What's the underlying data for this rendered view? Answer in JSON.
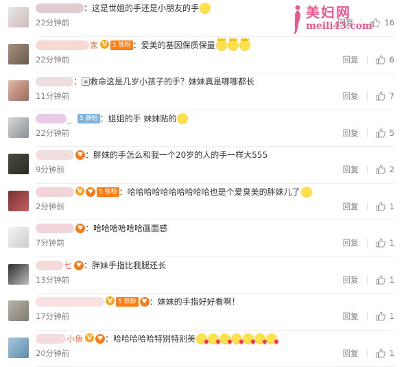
{
  "watermark": {
    "line1": "美妇网",
    "line2": "meili43.com"
  },
  "icons": {
    "like": "thumbs-up-icon"
  },
  "colors": {
    "name_tail": "#eb7350",
    "link_time": "#808080",
    "vip": "#ffa31a"
  },
  "comments": [
    {
      "name_tail": "",
      "name_blur_color": "#c9a4a8",
      "name_blur_width": 70,
      "badges": [],
      "text": "：这是世姐的手还是小朋友的手",
      "emojis": [
        "smile"
      ],
      "time": "22分钟前",
      "reply": "回复",
      "likes": "16",
      "avatar": [
        "#e9e9e9",
        "#d0b8b8"
      ]
    },
    {
      "name_tail": "家",
      "name_blur_color": "#f0b9b0",
      "name_blur_width": 78,
      "badges": [
        "v",
        "lvl-orange-铁粉"
      ],
      "text": "：爱美的基因保质保量",
      "emojis": [
        "crown",
        "crown",
        "crown"
      ],
      "time": "22分钟前",
      "reply": "回复",
      "likes": "6",
      "avatar": [
        "#a7907c",
        "#6b5a50"
      ]
    },
    {
      "name_tail": "",
      "name_blur_color": "#dcc2c2",
      "name_blur_width": 55,
      "badges": [],
      "text": "：救命这是几岁小孩子的手？妹妹真是哪哪都长",
      "emojis": [],
      "pre_icon": "▣",
      "time": "11分钟前",
      "reply": "回复",
      "likes": "7",
      "avatar": [
        "#e3b6a8",
        "#9c6b5d"
      ]
    },
    {
      "name_tail": "_",
      "name_blur_color": "#d8a3d3",
      "name_blur_width": 45,
      "badges": [
        "lvl-blue-铁粉"
      ],
      "text": "：姐姐的手 妹妹贴的",
      "emojis": [
        "smile"
      ],
      "time": "22分钟前",
      "reply": "回复",
      "likes": "5",
      "avatar": [
        "#d8d8d8",
        "#8a9096"
      ]
    },
    {
      "name_tail": "",
      "name_blur_color": "#e8c2c2",
      "name_blur_width": 56,
      "badges": [
        "heart"
      ],
      "text": "：胖妹的手怎么和我一个20岁的人的手一样大555",
      "emojis": [],
      "time": "9分钟前",
      "reply": "回复",
      "likes": "2",
      "avatar": [
        "#4c4c40",
        "#2a2a22"
      ]
    },
    {
      "name_tail": "",
      "name_blur_color": "#eab0b8",
      "name_blur_width": 56,
      "badges": [
        "v",
        "heart",
        "lvl-orange-铁粉"
      ],
      "text": "：哈哈哈哈哈哈哈哈哈哈也是个爱臭美的胖妹儿了",
      "emojis": [
        "laugh"
      ],
      "time": "2分钟前",
      "reply": "回复",
      "likes": "1",
      "avatar": [
        "#7a2f2f",
        "#c46060"
      ]
    },
    {
      "name_tail": "",
      "name_blur_color": "#e4b4bc",
      "name_blur_width": 56,
      "badges": [
        "heart"
      ],
      "text": "：哈哈哈哈哈哈画面感",
      "emojis": [],
      "time": "7分钟前",
      "reply": "回复",
      "likes": "1",
      "avatar": [
        "#f4f4f4",
        "#cccccc"
      ]
    },
    {
      "name_tail": "七",
      "name_blur_color": "#ecbcbf",
      "name_blur_width": 40,
      "badges": [
        "heart"
      ],
      "text": "：胖妹手指比我腿还长",
      "emojis": [],
      "time": "13分钟前",
      "reply": "回复",
      "likes": "1",
      "avatar": [
        "#2d2d2d",
        "#bdbdbd"
      ]
    },
    {
      "name_tail": "",
      "name_blur_color": "#f0c8c8",
      "name_blur_width": 100,
      "badges": [
        "v",
        "lvl-orange-铁粉",
        "heart"
      ],
      "text": "：妹妹的手指好好看啊！",
      "emojis": [],
      "time": "17分钟前",
      "reply": "回复",
      "likes": "1",
      "avatar": [
        "#b9b4a8",
        "#7d7a70"
      ]
    },
    {
      "name_tail": "小鱼",
      "name_blur_color": "#ecc0c6",
      "name_blur_width": 44,
      "badges": [
        "v",
        "heart"
      ],
      "text": "：哈哈哈哈哈特别特别美",
      "emojis": [
        "kiss",
        "kiss",
        "kiss",
        "kiss",
        "kiss",
        "kiss",
        "kiss"
      ],
      "time": "20分钟前",
      "reply": "回复",
      "likes": "1",
      "avatar": [
        "#a8c8e0",
        "#5f8aa8"
      ]
    }
  ]
}
